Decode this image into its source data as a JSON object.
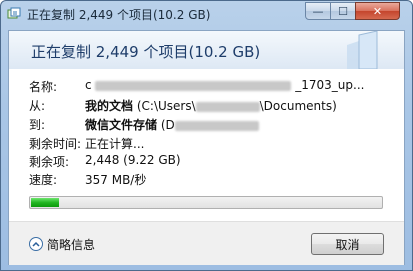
{
  "window": {
    "title": "正在复制 2,449 个项目(10.2 GB)",
    "close_symbol": "✕",
    "minimize_symbol": "—",
    "maximize_symbol": "☐"
  },
  "header": {
    "title": "正在复制 2,449 个项目(10.2 GB)"
  },
  "details": {
    "name": {
      "label": "名称:",
      "value_prefix": "c",
      "value_suffix": "_1703_up..."
    },
    "from": {
      "label": "从:",
      "value_bold": "我的文档",
      "value_prefix": "(C:\\Users\\",
      "value_suffix": "\\Documents)"
    },
    "to": {
      "label": "到:",
      "value_bold": "微信文件存储",
      "value_prefix": "(D"
    },
    "time_remaining": {
      "label": "剩余时间:",
      "value": "正在计算..."
    },
    "items_remaining": {
      "label": "剩余项:",
      "value": "2,448 (9.22 GB)"
    },
    "speed": {
      "label": "速度:",
      "value": "357 MB/秒"
    }
  },
  "progress": {
    "fraction": 0.08,
    "color": "#22b522"
  },
  "footer": {
    "details_toggle_label": "简略信息",
    "cancel_label": "取消"
  },
  "icons": [
    "copy-dialog-icon",
    "chevron-up-icon"
  ]
}
